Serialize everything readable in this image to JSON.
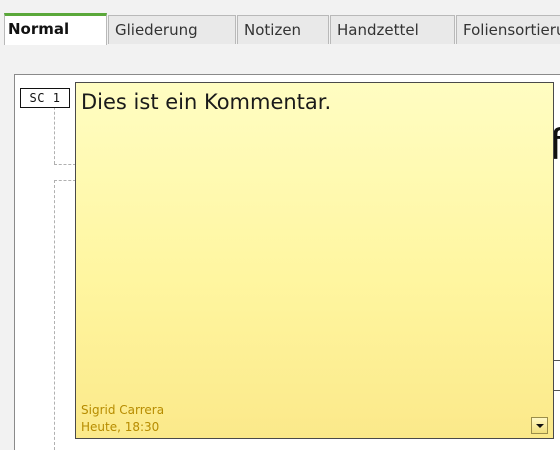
{
  "tabs": [
    {
      "label": "Normal",
      "active": true
    },
    {
      "label": "Gliederung",
      "active": false
    },
    {
      "label": "Notizen",
      "active": false
    },
    {
      "label": "Handzettel",
      "active": false
    },
    {
      "label": "Foliensortierung",
      "active": false
    }
  ],
  "comment": {
    "marker_label": "SC 1",
    "text": "Dies ist ein Kommentar.",
    "author": "Sigrid Carrera",
    "date": "Heute, 18:30",
    "menu_icon": "chevron-down-icon"
  },
  "slide": {
    "partial_glyph": "f"
  },
  "colors": {
    "active_tab_accent": "#5aa83a",
    "note_background": "#fff6a0",
    "note_meta_text": "#b78c00"
  }
}
